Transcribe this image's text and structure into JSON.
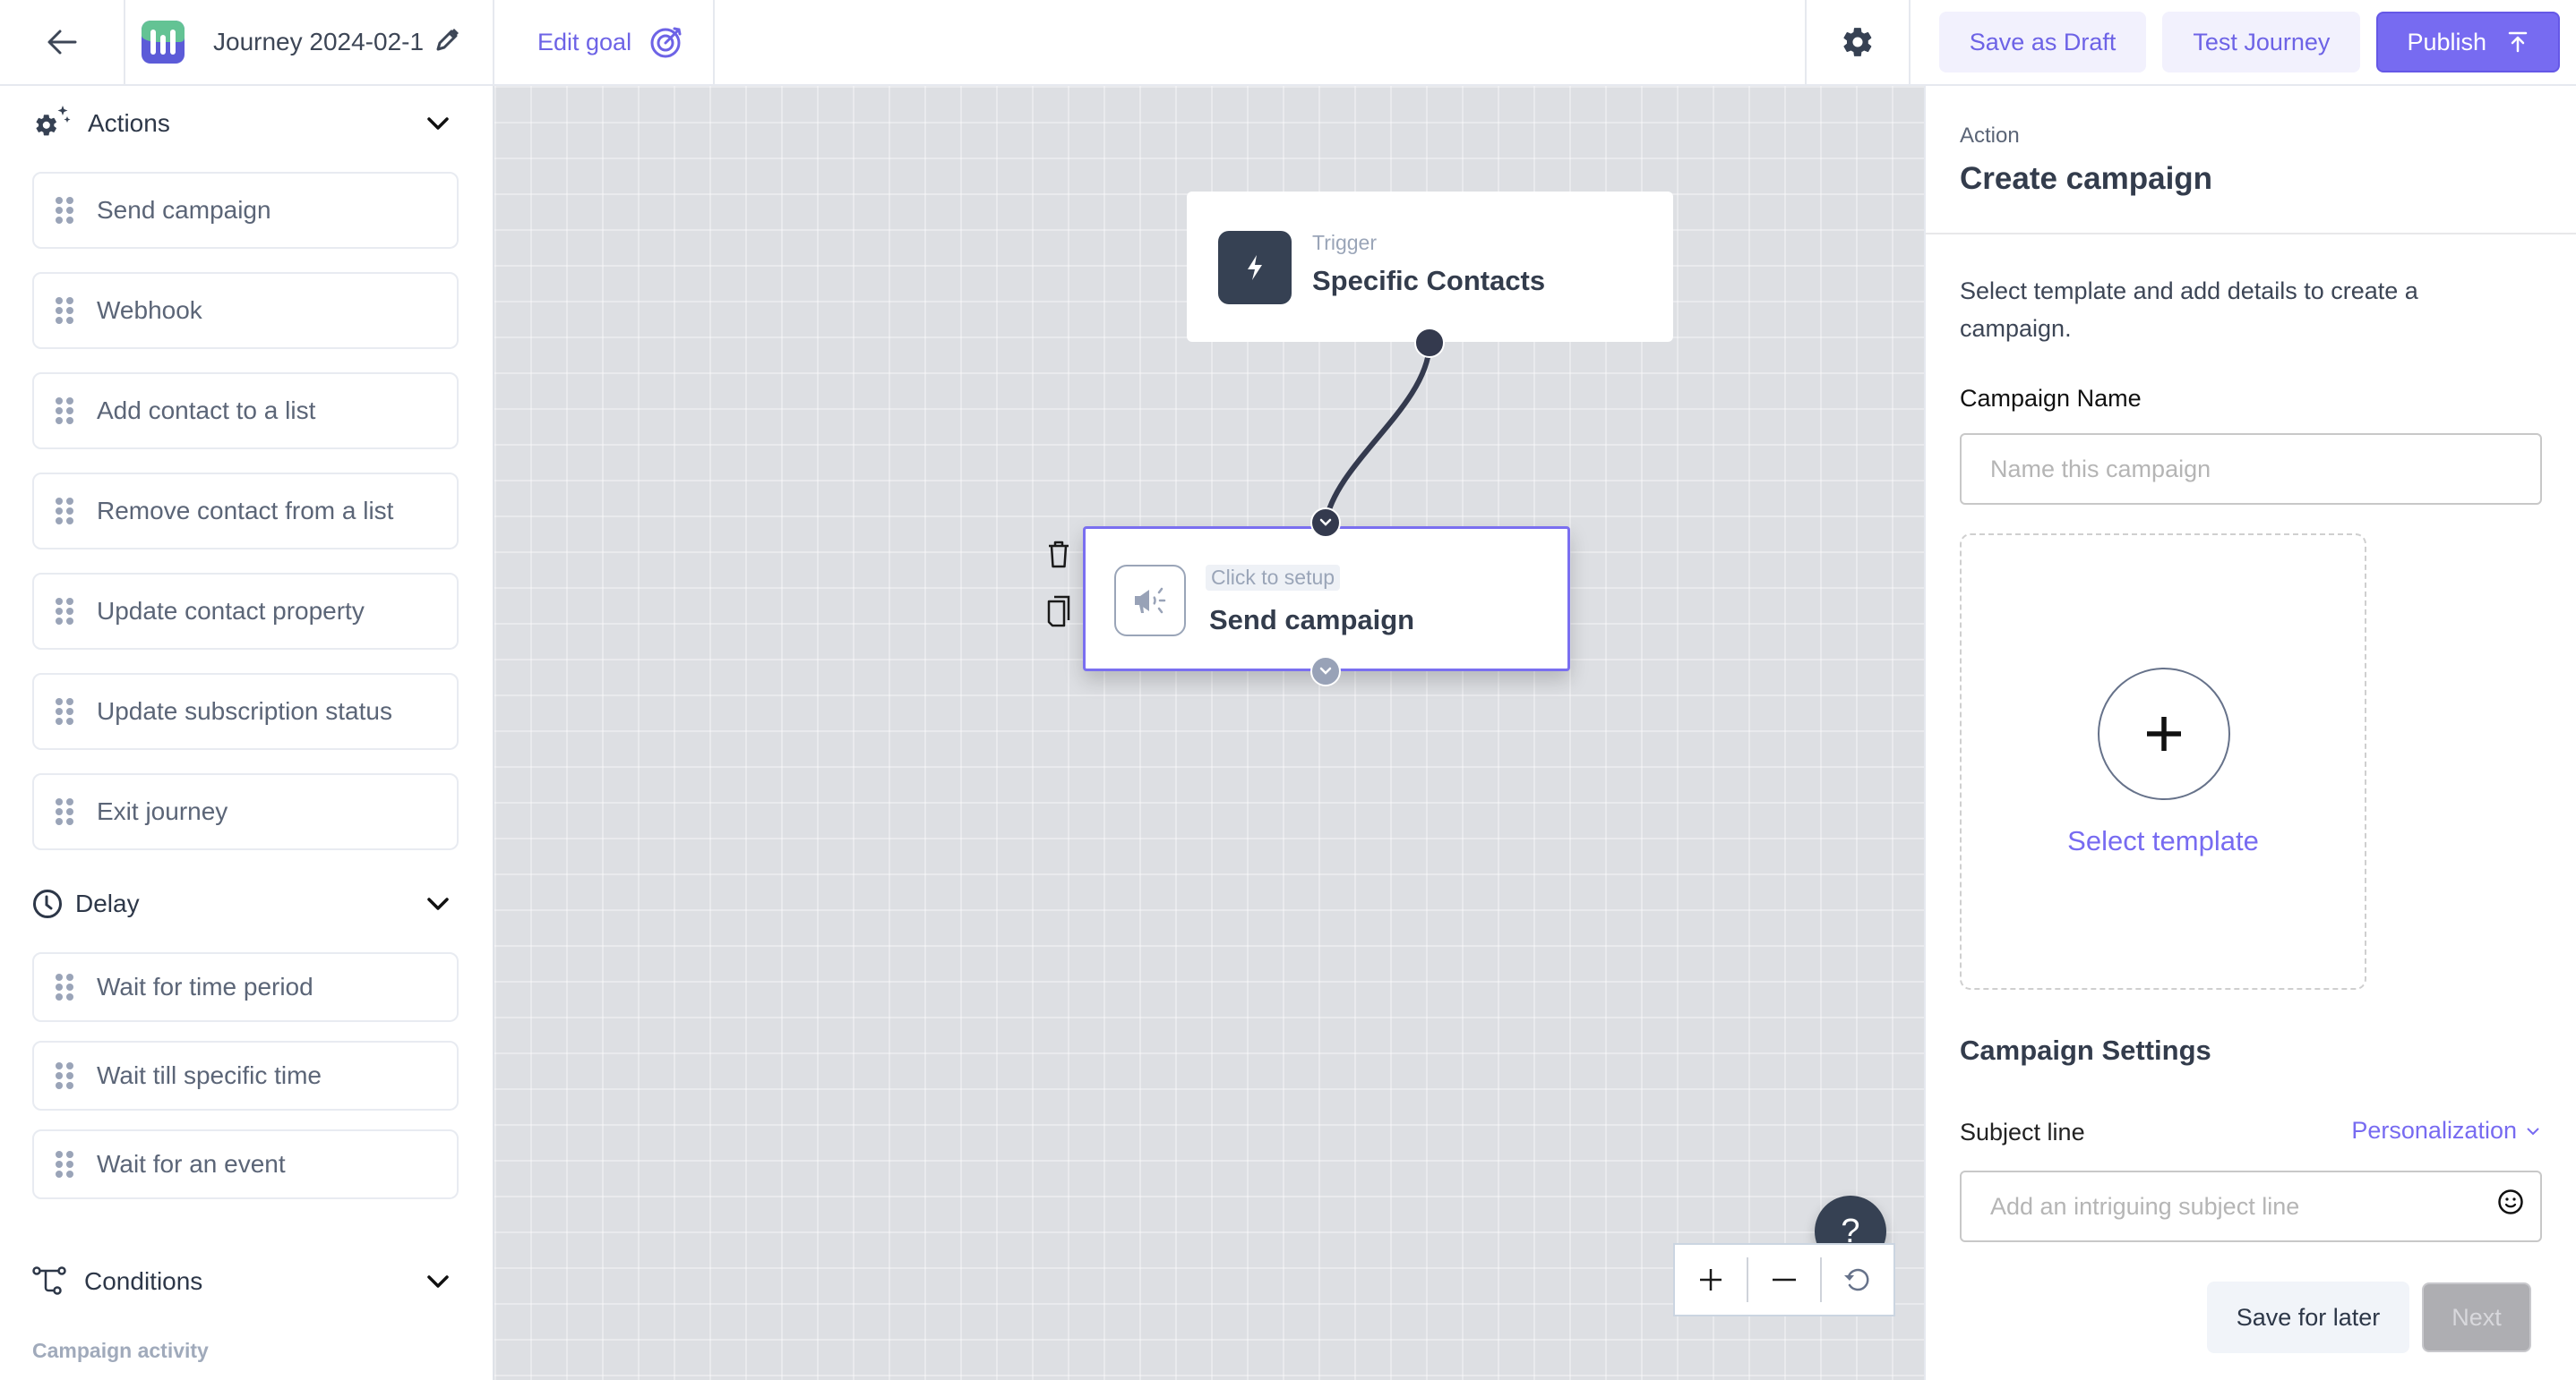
{
  "header": {
    "back_icon": "arrow-left-icon",
    "logo_icon": "app-logo-icon",
    "journey_name": "Journey 2024-02-1",
    "edit_name_icon": "pencil-icon",
    "edit_goal_label": "Edit goal",
    "goal_icon": "target-icon",
    "settings_icon": "gear-icon",
    "save_draft_label": "Save as Draft",
    "test_journey_label": "Test Journey",
    "publish_label": "Publish",
    "publish_icon": "upload-arrow-icon",
    "accent_color": "#776bf1"
  },
  "sidebar": {
    "sections": [
      {
        "title": "Actions",
        "icon": "gear-sparkle-icon",
        "items": [
          {
            "label": "Send campaign"
          },
          {
            "label": "Webhook"
          },
          {
            "label": "Add contact to a list"
          },
          {
            "label": "Remove contact from a list"
          },
          {
            "label": "Update contact property"
          },
          {
            "label": "Update subscription status"
          },
          {
            "label": "Exit journey"
          }
        ]
      },
      {
        "title": "Delay",
        "icon": "clock-icon",
        "items": [
          {
            "label": "Wait for time period"
          },
          {
            "label": "Wait till specific time"
          },
          {
            "label": "Wait for an event"
          }
        ]
      },
      {
        "title": "Conditions",
        "icon": "branch-icon",
        "subcaption": "Campaign activity"
      }
    ]
  },
  "canvas": {
    "trigger_node": {
      "kicker": "Trigger",
      "title": "Specific Contacts",
      "icon": "lightning-icon"
    },
    "action_node": {
      "kicker": "Click to setup",
      "title": "Send campaign",
      "icon": "megaphone-icon",
      "selected": true
    },
    "node_tools": [
      "trash-icon",
      "copy-icon"
    ],
    "help_label": "?",
    "zoom_controls": [
      "zoom-in-icon",
      "zoom-out-icon",
      "reset-icon"
    ]
  },
  "panel": {
    "kicker": "Action",
    "title": "Create campaign",
    "description": "Select template and add details to create a campaign.",
    "campaign_name_label": "Campaign Name",
    "campaign_name_value": "",
    "campaign_name_placeholder": "Name this campaign",
    "select_template_label": "Select template",
    "settings_heading": "Campaign Settings",
    "subject_label": "Subject line",
    "personalization_label": "Personalization",
    "subject_value": "",
    "subject_placeholder": "Add an intriguing subject line",
    "save_later_label": "Save for later",
    "next_label": "Next",
    "next_disabled": true
  }
}
